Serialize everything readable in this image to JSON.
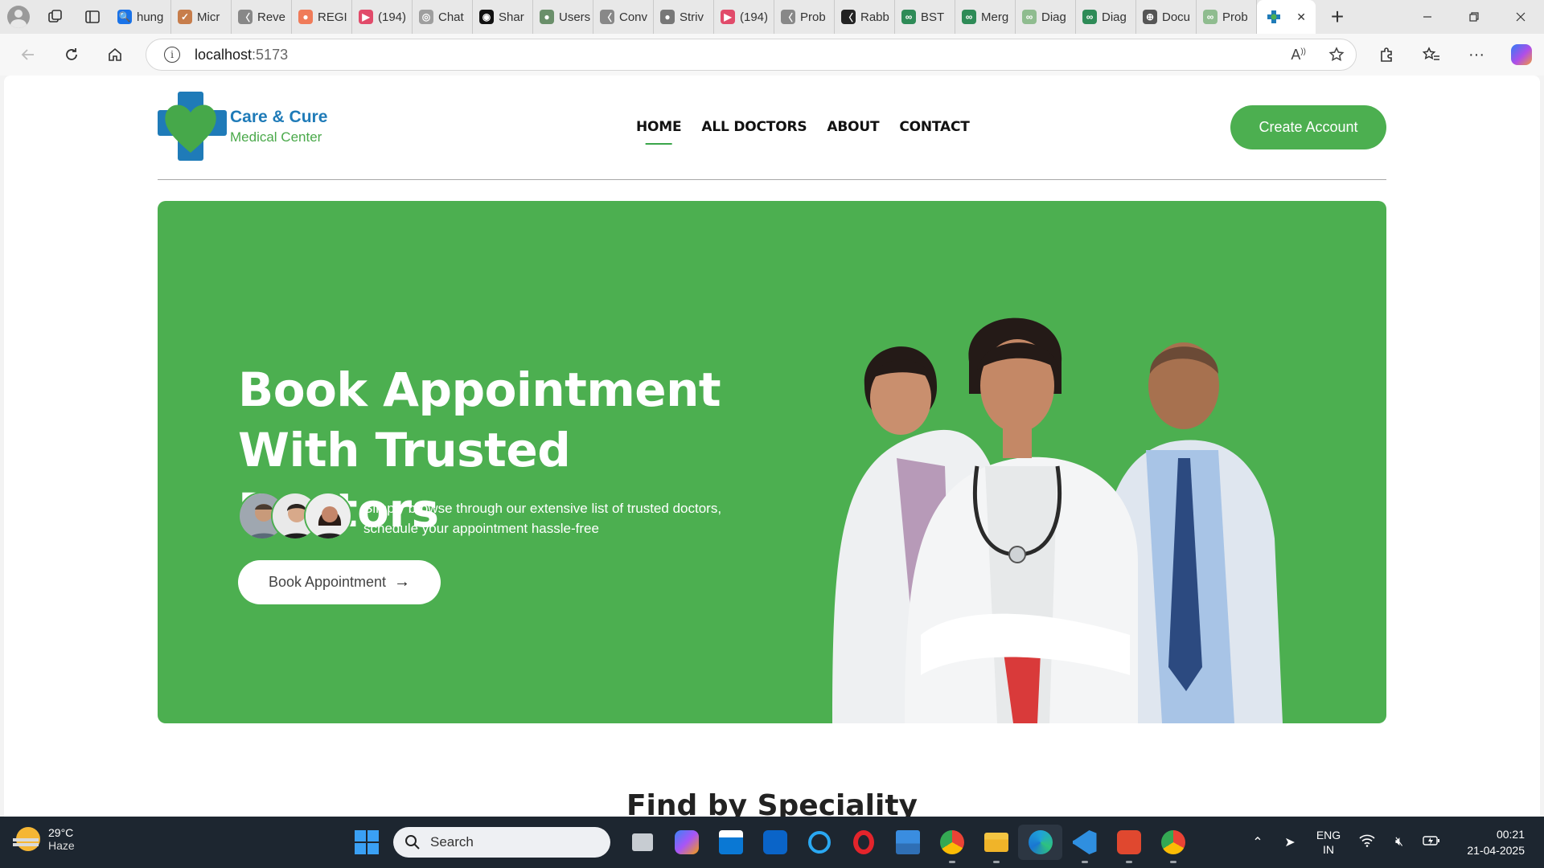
{
  "browser": {
    "tabs": [
      {
        "label": "hung",
        "color": "#1a73e8",
        "glyph": "🔍"
      },
      {
        "label": "Micr",
        "color": "#c77d4b",
        "glyph": "✓"
      },
      {
        "label": "Reve",
        "color": "#888888",
        "glyph": "〈"
      },
      {
        "label": "REGI",
        "color": "#f07b59",
        "glyph": "●"
      },
      {
        "label": "(194)",
        "color": "#e14b6a",
        "glyph": "▶"
      },
      {
        "label": "Chat",
        "color": "#9e9e9e",
        "glyph": "◎"
      },
      {
        "label": "Shar",
        "color": "#111111",
        "glyph": "◉"
      },
      {
        "label": "Users",
        "color": "#6a8f6a",
        "glyph": "●"
      },
      {
        "label": "Conv",
        "color": "#888888",
        "glyph": "〈"
      },
      {
        "label": "Striv",
        "color": "#777777",
        "glyph": "●"
      },
      {
        "label": "(194)",
        "color": "#e14b6a",
        "glyph": "▶"
      },
      {
        "label": "Prob",
        "color": "#888888",
        "glyph": "〈"
      },
      {
        "label": "Rabb",
        "color": "#222222",
        "glyph": "〈"
      },
      {
        "label": "BST",
        "color": "#2e8b57",
        "glyph": "∞"
      },
      {
        "label": "Merg",
        "color": "#2e8b57",
        "glyph": "∞"
      },
      {
        "label": "Diag",
        "color": "#8fbc8f",
        "glyph": "∞"
      },
      {
        "label": "Diag",
        "color": "#2e8b57",
        "glyph": "∞"
      },
      {
        "label": "Docu",
        "color": "#555555",
        "glyph": "⊕"
      },
      {
        "label": "Prob",
        "color": "#8fbc8f",
        "glyph": "∞"
      }
    ],
    "active_tab_close": "✕",
    "new_tab": "+",
    "url_host": "localhost",
    "url_port": ":5173"
  },
  "site": {
    "logo_title": "Care & Cure",
    "logo_subtitle": "Medical Center",
    "nav": [
      {
        "label": "HOME",
        "active": true
      },
      {
        "label": "ALL DOCTORS",
        "active": false
      },
      {
        "label": "ABOUT",
        "active": false
      },
      {
        "label": "CONTACT",
        "active": false
      }
    ],
    "cta_label": "Create Account",
    "hero": {
      "title_line1": "Book Appointment",
      "title_line2": "With Trusted Doctors",
      "description": "Simply browse through our extensive list of trusted doctors, schedule your appointment hassle-free",
      "button_label": "Book Appointment",
      "button_arrow": "→"
    },
    "section_title": "Find by Speciality",
    "colors": {
      "primary": "#4caf50",
      "logo_blue": "#1f7bb8"
    }
  },
  "taskbar": {
    "temperature": "29°C",
    "condition": "Haze",
    "search_placeholder": "Search",
    "language_line1": "ENG",
    "language_line2": "IN",
    "time": "00:21",
    "date": "21-04-2025"
  }
}
